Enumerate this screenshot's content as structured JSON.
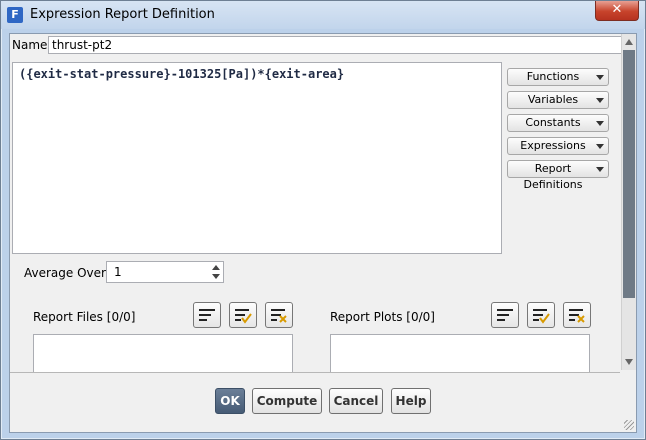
{
  "window": {
    "title": "Expression Report Definition",
    "app_icon_letter": "F",
    "close_glyph": "✕"
  },
  "name": {
    "label": "Name",
    "value": "thrust-pt2"
  },
  "expression": {
    "text": "({exit-stat-pressure}-101325[Pa])*{exit-area}"
  },
  "side_buttons": [
    {
      "label": "Functions",
      "icon": "chevron-down-icon"
    },
    {
      "label": "Variables",
      "icon": "chevron-down-icon"
    },
    {
      "label": "Constants",
      "icon": "chevron-down-icon"
    },
    {
      "label": "Expressions",
      "icon": "chevron-down-icon"
    },
    {
      "label": "Report Definitions",
      "icon": "chevron-down-icon"
    }
  ],
  "average_over": {
    "label": "Average Over",
    "value": "1"
  },
  "report_files": {
    "label": "Report Files",
    "count": "[0/0]"
  },
  "report_plots": {
    "label": "Report Plots",
    "count": "[0/0]"
  },
  "buttons": {
    "ok": "OK",
    "compute": "Compute",
    "cancel": "Cancel",
    "help": "Help"
  },
  "colors": {
    "ok_button": "#4f6480",
    "title_bar": "#c7d9ee",
    "close_button": "#c7432b"
  }
}
